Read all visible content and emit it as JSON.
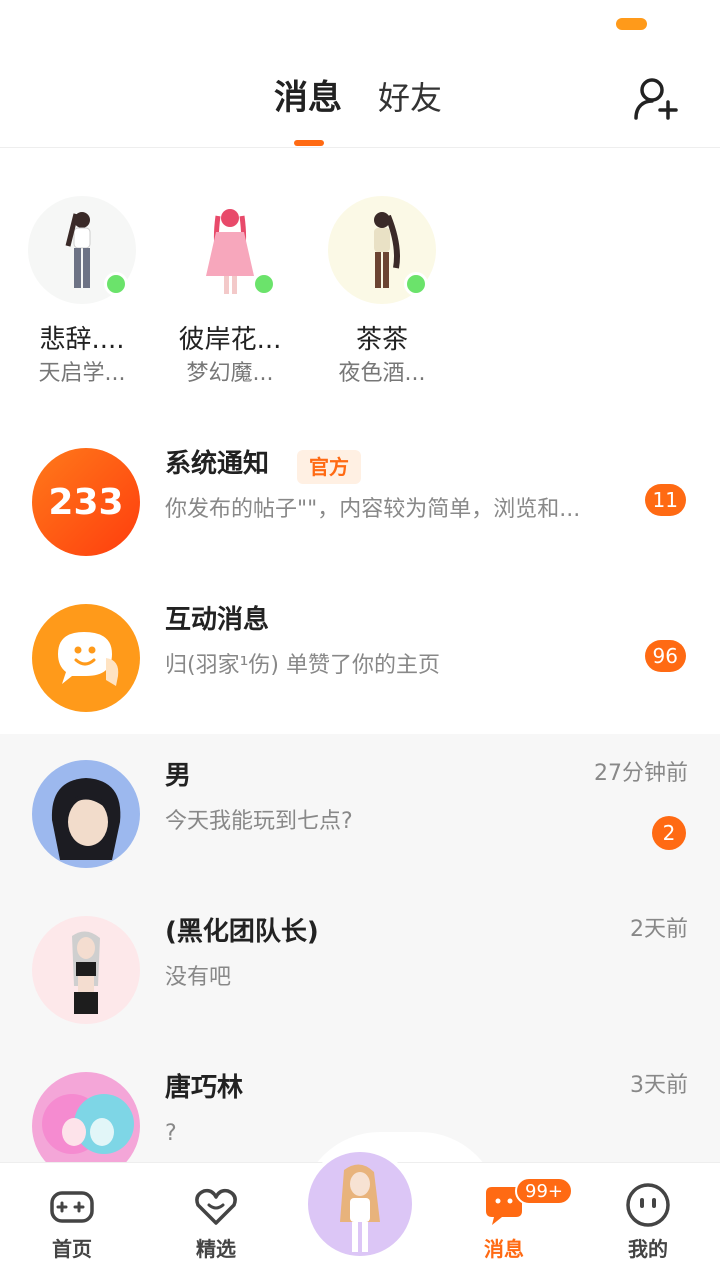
{
  "header": {
    "tabs": [
      {
        "label": "消息",
        "active": true
      },
      {
        "label": "好友",
        "active": false
      }
    ]
  },
  "friends": [
    {
      "name": "悲辞....",
      "sub": "天启学..."
    },
    {
      "name": "彼岸花...",
      "sub": "梦幻魔..."
    },
    {
      "name": "茶茶",
      "sub": "夜色酒..."
    }
  ],
  "messages": [
    {
      "title": "系统通知",
      "tag": "官方",
      "preview": "你发布的帖子\"\"，内容较为简单，浏览和...",
      "badge": "11",
      "avatar_text": "233"
    },
    {
      "title": "互动消息",
      "preview": "归(羽家¹伤) 单赞了你的主页",
      "badge": "96"
    },
    {
      "title": "男",
      "preview": "今天我能玩到七点?",
      "time": "27分钟前",
      "badge": "2"
    },
    {
      "title": "(黑化团队长)",
      "preview": "没有吧",
      "time": "2天前"
    },
    {
      "title": "唐巧林",
      "preview": "?",
      "time": "3天前"
    }
  ],
  "bottom_nav": {
    "items": [
      {
        "label": "首页"
      },
      {
        "label": "精选"
      },
      {
        "label": "消息",
        "badge": "99+"
      },
      {
        "label": "我的"
      }
    ]
  },
  "colors": {
    "accent": "#ff6a13",
    "online": "#6be36b"
  }
}
